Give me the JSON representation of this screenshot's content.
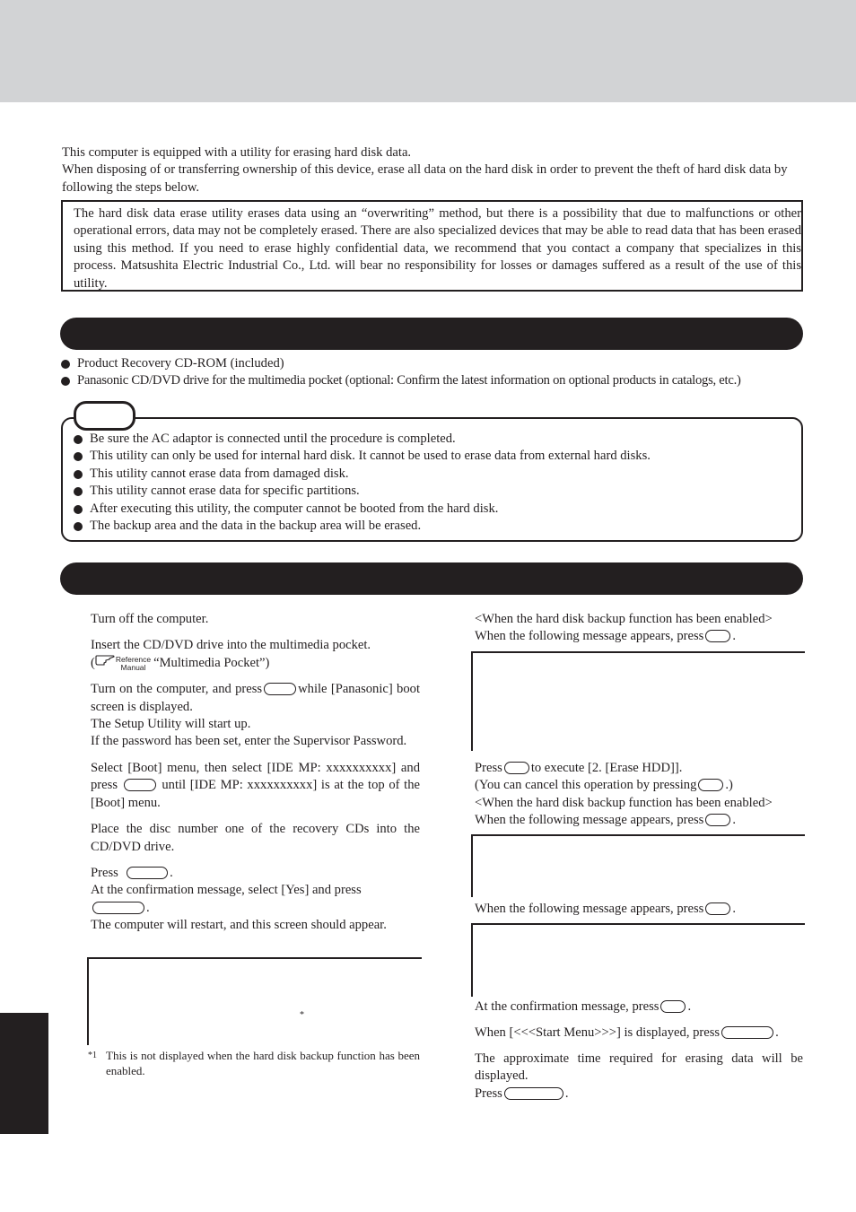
{
  "intro": {
    "line1": "This computer is equipped with a utility for erasing hard disk data.",
    "line2": "When disposing of or transferring ownership of this device, erase all data on the hard disk in order to prevent the theft of hard disk data by following the steps below."
  },
  "warning": {
    "text": "The hard disk data erase utility erases data using an “overwriting” method, but there is a possibility that due to malfunctions or other operational errors, data may not be completely erased. There are also specialized devices that may be able to read data that has been erased using this method. If you need to erase highly confidential data, we recommend that you contact a company that specializes in this process. Matsushita Electric Industrial Co., Ltd. will bear no responsibility for losses or damages suffered as a result of the use of this utility."
  },
  "requirements": {
    "items": [
      "Product Recovery CD-ROM (included)",
      "Panasonic CD/DVD drive for the multimedia pocket (optional: Confirm the latest information on optional products in catalogs, etc.)"
    ]
  },
  "caution": {
    "items": [
      "Be sure the AC adaptor is connected until the procedure is completed.",
      "This utility can only be used for internal hard disk.  It cannot be used to erase data from external hard disks.",
      "This utility cannot erase data from damaged disk.",
      "This utility cannot erase data for specific partitions.",
      "After executing this utility, the computer cannot be booted from the hard disk.",
      "The backup area and the data in the backup area will be erased."
    ]
  },
  "steps_left": {
    "s1": "Turn off the computer.",
    "s2_line1": "Insert the CD/DVD drive into the multimedia pocket.",
    "s2_ref_open": "(",
    "s2_ref_top": "Reference",
    "s2_ref_bottom": "Manual",
    "s2_ref_text": "“Multimedia Pocket”)",
    "s3_a": "Turn on the computer, and press",
    "s3_b": "while [Panasonic] boot screen is displayed.",
    "s3_c": "The Setup Utility will start up.",
    "s3_d": "If the password has been set, enter the Supervisor Password.",
    "s4_a": "Select [Boot] menu, then select [IDE MP:  xxxxxxxxxx] and press",
    "s4_b": "until [IDE MP:  xxxxxxxxxx] is at the top of the [Boot] menu.",
    "s5": "Place the disc number one of the recovery CDs into the CD/DVD drive.",
    "s6_a": "Press",
    "s6_b": ".",
    "s6_c": "At the confirmation message, select [Yes] and press",
    "s6_d": ".",
    "s6_e": "The computer will restart, and this screen should appear.",
    "screen_asterisk": "*",
    "footnote_mark": "*1",
    "footnote_text": "This is not displayed when the hard disk backup function has been enabled."
  },
  "steps_right": {
    "b1_a": "<When the hard disk backup function has been enabled>",
    "b1_b": "When the following message appears, press",
    "b1_c": ".",
    "b2_a": "Press",
    "b2_b": "to execute [2. [Erase HDD]].",
    "b2_c": "(You can cancel this operation by pressing",
    "b2_d": ".)",
    "b2_e": "<When the hard disk backup function has been enabled>",
    "b2_f": "When the following message appears, press",
    "b2_g": ".",
    "b3_a": "When the following message appears, press",
    "b3_b": ".",
    "b4_a": "At the confirmation message, press",
    "b4_b": ".",
    "b5_a": "When [<<<Start Menu>>>] is displayed, press",
    "b5_b": ".",
    "b6_a": "The approximate time required for erasing data will be displayed.",
    "b6_b": "Press",
    "b6_c": "."
  }
}
